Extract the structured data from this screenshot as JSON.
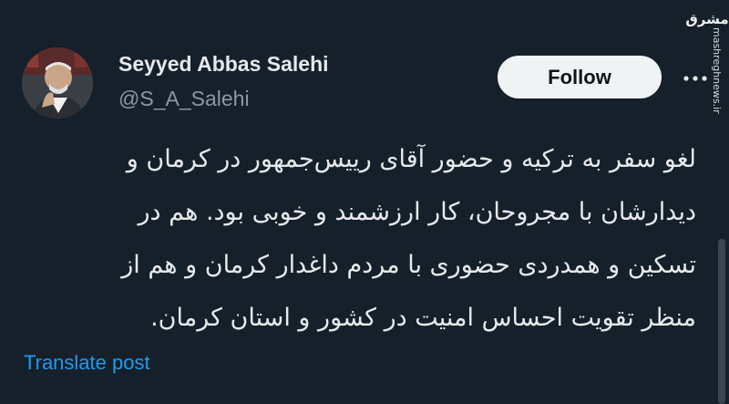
{
  "tweet": {
    "author_name": "Seyyed Abbas Salehi",
    "handle": "@S_A_Salehi",
    "follow_label": "Follow",
    "body_lines": [
      "لغو سفر به ترکیه و حضور آقای رییس‌جمهور در کرمان و",
      "دیدارشان با مجروحان، کار ارزشمند و خوبی بود. هم در",
      "تسکین و همدردی حضوری با مردم داغدار کرمان و هم از",
      "منظر تقویت احساس امنیت در کشور و استان کرمان."
    ],
    "translate_label": "Translate post"
  },
  "watermark": {
    "logo": "مشرق",
    "url": "mashreghnews.ir"
  },
  "icons": {
    "more": "more-options-icon",
    "avatar": "profile-photo"
  },
  "colors": {
    "background": "#15202b",
    "text": "#e7e9ea",
    "muted": "#8b98a5",
    "link": "#1d9bf0",
    "follow_bg": "#eff3f4"
  }
}
